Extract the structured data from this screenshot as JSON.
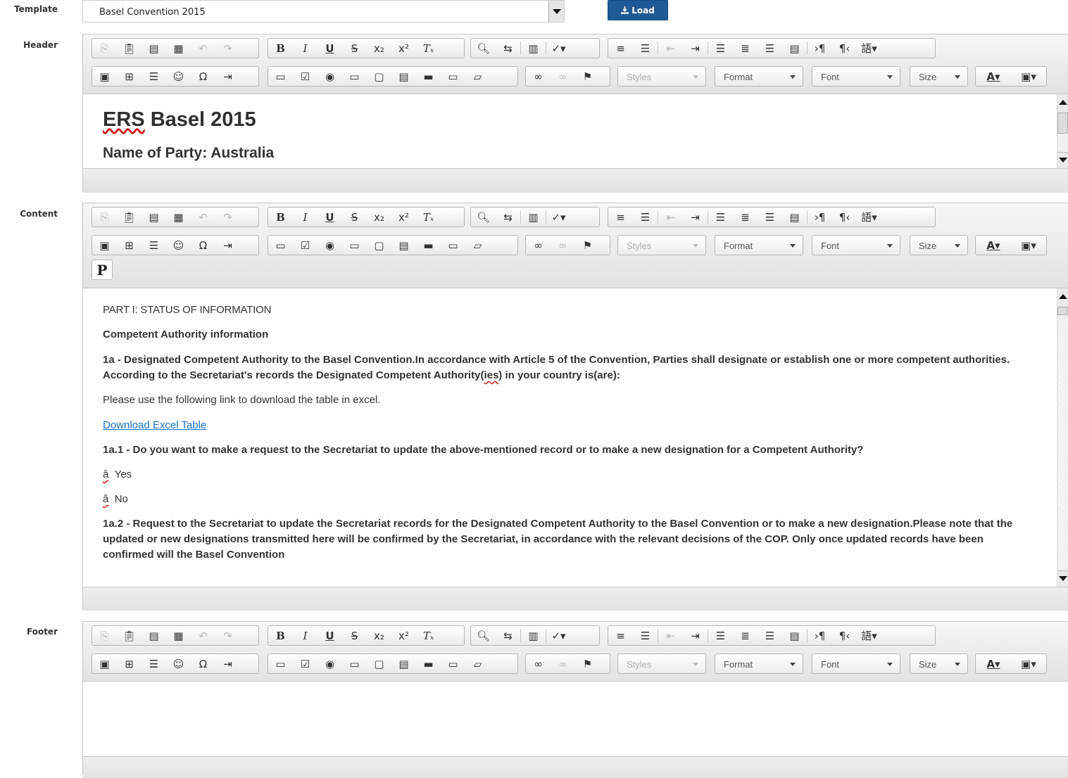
{
  "labels": {
    "template": "Template",
    "header": "Header",
    "content": "Content",
    "footer": "Footer"
  },
  "template": {
    "selected": "Basel Convention 2015",
    "load_label": "Load"
  },
  "toolbar": {
    "styles": "Styles",
    "format": "Format",
    "font": "Font",
    "size": "Size",
    "text_color": "A",
    "bg_color": "▣",
    "p_label": "P",
    "bold": "B",
    "italic": "I",
    "underline": "U",
    "strike": "S",
    "subscript": "x₂",
    "superscript": "x²",
    "remove_format": "Tₓ"
  },
  "header_editor": {
    "title_word1": "ERS",
    "title_rest": " Basel 2015",
    "party": "Name of Party: Australia"
  },
  "content_editor": {
    "part": "PART I: STATUS OF INFORMATION",
    "section": "Competent Authority information",
    "q1a_pre": "1a - Designated Competent Authority to the Basel Convention.In accordance with Article 5 of the Convention, Parties shall designate or establish one or more competent authorities. According to the Secretariat's records the Designated Competent Authority(",
    "q1a_ies": "ies",
    "q1a_post": ") in your country is(are):",
    "use_link": "Please use the following link to download the table in excel.",
    "download": "Download Excel Table",
    "q1a1": "1a.1 - Do you want to make a request to the Secretariat to update the above-mentioned record or to make a new designation for a Competent Authority?",
    "radio_glyph": "â",
    "yes": "Yes",
    "no": "No",
    "q1a2": "1a.2 - Request to the Secretariat to update the Secretariat records for the Designated Competent Authority to the Basel Convention or to make a new designation.Please note that the updated or new designations transmitted here will be confirmed by the Secretariat, in accordance with the relevant decisions of the COP. Only once updated records have been confirmed will the Basel Convention"
  },
  "footer_editor": {
    "text": ""
  }
}
